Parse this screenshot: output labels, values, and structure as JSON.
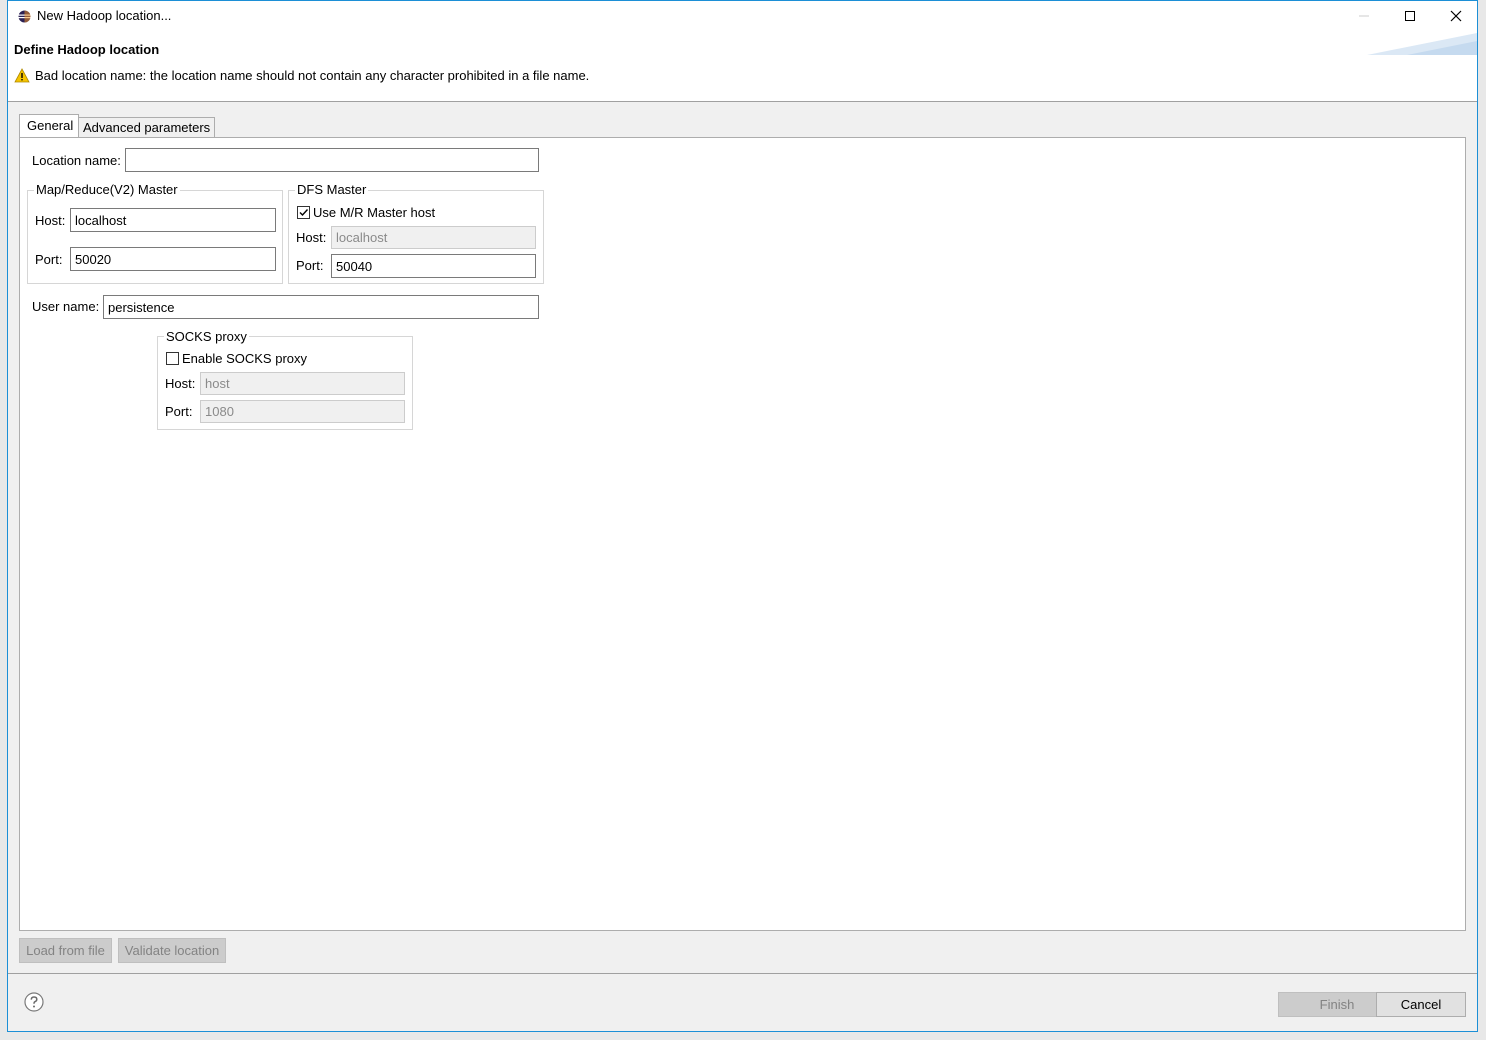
{
  "window": {
    "title": "New Hadoop location..."
  },
  "header": {
    "title": "Define Hadoop location",
    "warning": "Bad location name: the location name should not contain any character prohibited in a file name."
  },
  "tabs": [
    {
      "label": "General",
      "active": true
    },
    {
      "label": "Advanced parameters",
      "active": false
    }
  ],
  "general": {
    "location_name_label": "Location name:",
    "location_name_value": "",
    "mr_master": {
      "title": "Map/Reduce(V2) Master",
      "host_label": "Host:",
      "host_value": "localhost",
      "port_label": "Port:",
      "port_value": "50020"
    },
    "dfs_master": {
      "title": "DFS Master",
      "use_mr_host_label": "Use M/R Master host",
      "use_mr_host_checked": true,
      "host_label": "Host:",
      "host_value": "localhost",
      "port_label": "Port:",
      "port_value": "50040"
    },
    "user_name_label": "User name:",
    "user_name_value": "persistence",
    "socks": {
      "title": "SOCKS proxy",
      "enable_label": "Enable SOCKS proxy",
      "enable_checked": false,
      "host_label": "Host:",
      "host_value": "host",
      "port_label": "Port:",
      "port_value": "1080"
    }
  },
  "actions": {
    "load_from_file": "Load from file",
    "validate_location": "Validate location"
  },
  "footer": {
    "finish": "Finish",
    "cancel": "Cancel"
  },
  "colors": {
    "window_border": "#1c8fd6",
    "warning_yellow": "#f5c400",
    "disabled_button": "#cccccc"
  }
}
